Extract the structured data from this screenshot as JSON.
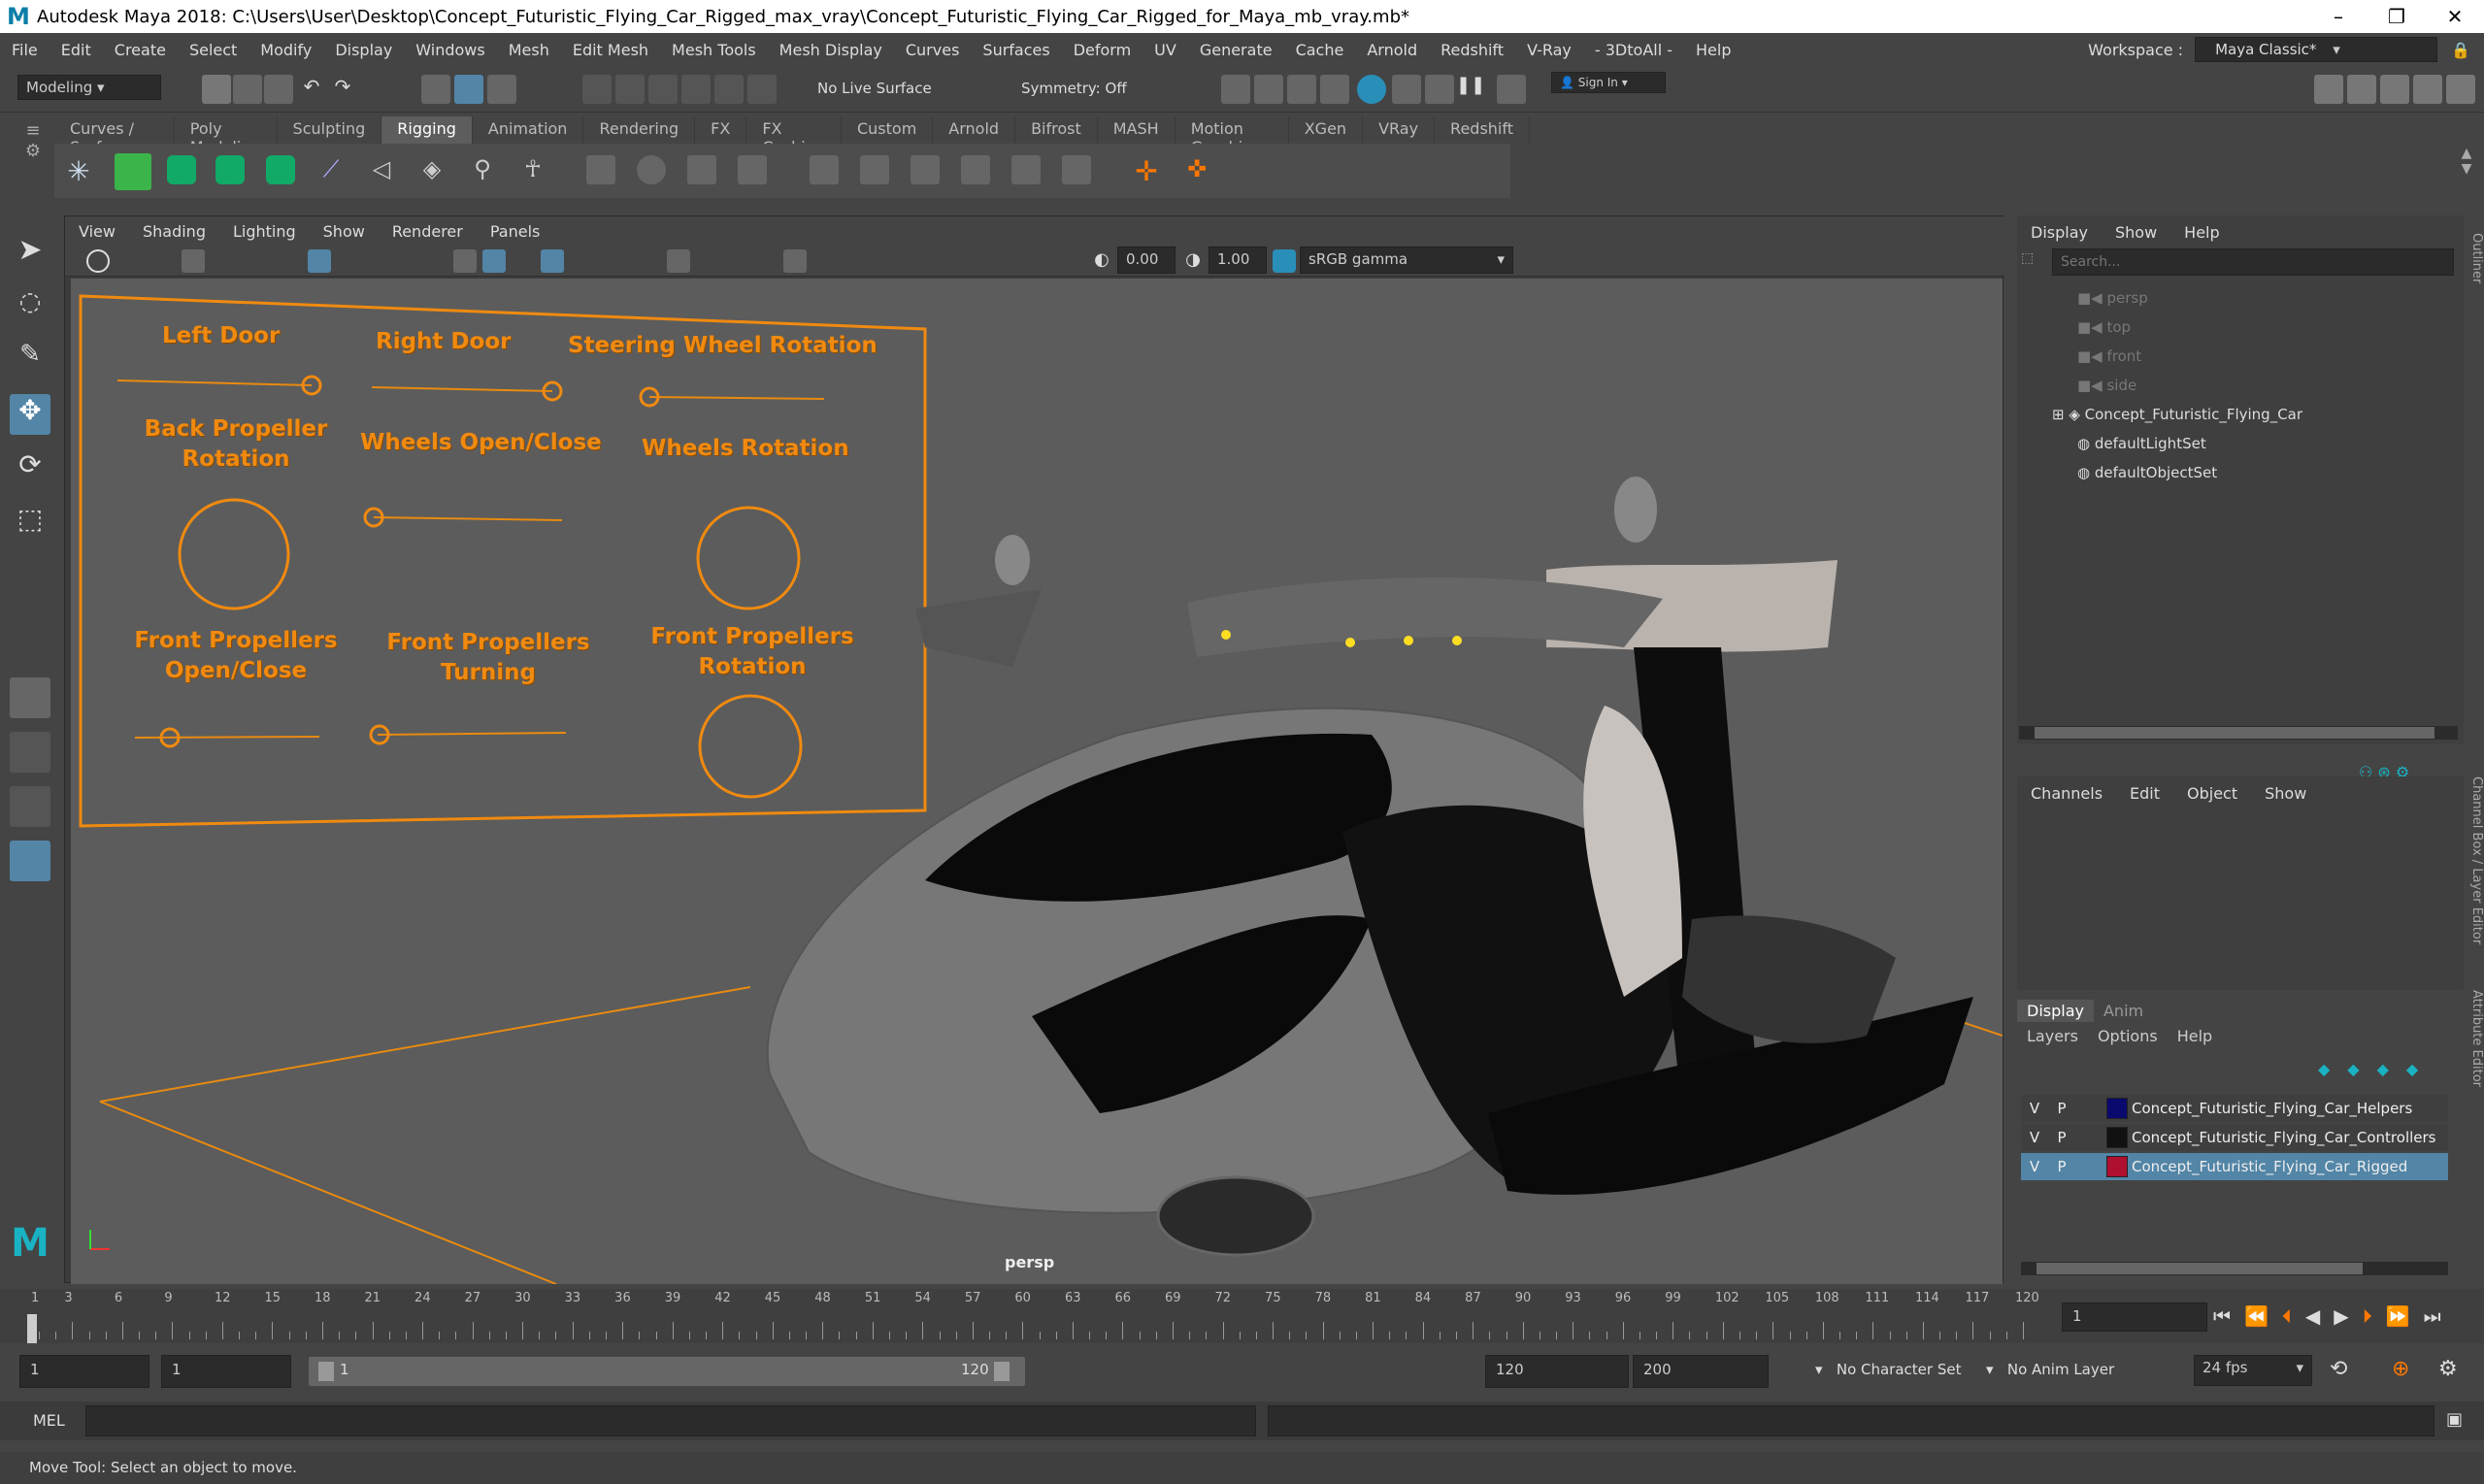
{
  "window": {
    "title": "Autodesk Maya 2018: C:\\Users\\User\\Desktop\\Concept_Futuristic_Flying_Car_Rigged_max_vray\\Concept_Futuristic_Flying_Car_Rigged_for_Maya_mb_vray.mb*",
    "min": "–",
    "max": "❐",
    "close": "✕"
  },
  "menu": [
    "File",
    "Edit",
    "Create",
    "Select",
    "Modify",
    "Display",
    "Windows",
    "Mesh",
    "Edit Mesh",
    "Mesh Tools",
    "Mesh Display",
    "Curves",
    "Surfaces",
    "Deform",
    "UV",
    "Generate",
    "Cache",
    "Arnold",
    "Redshift",
    "V-Ray",
    "- 3DtoAll -",
    "Help"
  ],
  "workspace": {
    "label": "Workspace :",
    "value": "Maya Classic*"
  },
  "status": {
    "mode": "Modeling",
    "live_surface": "No Live Surface",
    "symmetry": "Symmetry: Off",
    "sign_in": "Sign In"
  },
  "shelf_tabs": [
    "Curves / Surfaces",
    "Poly Modeling",
    "Sculpting",
    "Rigging",
    "Animation",
    "Rendering",
    "FX",
    "FX Caching",
    "Custom",
    "Arnold",
    "Bifrost",
    "MASH",
    "Motion Graphics",
    "XGen",
    "VRay",
    "Redshift"
  ],
  "shelf_active": "Rigging",
  "viewport": {
    "menu": [
      "View",
      "Shading",
      "Lighting",
      "Show",
      "Renderer",
      "Panels"
    ],
    "exposure": "0.00",
    "gamma": "1.00",
    "colorspace": "sRGB gamma",
    "camera": "persp"
  },
  "controls": {
    "left_door": "Left Door",
    "right_door": "Right Door",
    "steering": "Steering Wheel Rotation",
    "back_prop_1": "Back Propeller",
    "back_prop_2": "Rotation",
    "wheels_oc": "Wheels Open/Close",
    "wheels_rot": "Wheels Rotation",
    "fp_oc_1": "Front Propellers",
    "fp_oc_2": "Open/Close",
    "fp_turn_1": "Front Propellers",
    "fp_turn_2": "Turning",
    "fp_rot_1": "Front Propellers",
    "fp_rot_2": "Rotation"
  },
  "outliner": {
    "menu": [
      "Display",
      "Show",
      "Help"
    ],
    "search_placeholder": "Search...",
    "items": [
      "persp",
      "top",
      "front",
      "side",
      "Concept_Futuristic_Flying_Car",
      "defaultLightSet",
      "defaultObjectSet"
    ]
  },
  "channelbox": {
    "menu": [
      "Channels",
      "Edit",
      "Object",
      "Show"
    ]
  },
  "layers": {
    "tabs": [
      "Display",
      "Anim"
    ],
    "menu": [
      "Layers",
      "Options",
      "Help"
    ],
    "rows": [
      {
        "v": "V",
        "p": "P",
        "name": "Concept_Futuristic_Flying_Car_Helpers",
        "color": "#0a0a6e"
      },
      {
        "v": "V",
        "p": "P",
        "name": "Concept_Futuristic_Flying_Car_Controllers",
        "color": "#111111"
      },
      {
        "v": "V",
        "p": "P",
        "name": "Concept_Futuristic_Flying_Car_Rigged",
        "color": "#b01030"
      }
    ]
  },
  "side_tabs": [
    "Outliner",
    "Channel Box / Layer Editor",
    "Attribute Editor"
  ],
  "timeline": {
    "ticks": [
      "1",
      "3",
      "6",
      "9",
      "12",
      "15",
      "18",
      "21",
      "24",
      "27",
      "30",
      "33",
      "36",
      "39",
      "42",
      "45",
      "48",
      "51",
      "54",
      "57",
      "60",
      "63",
      "66",
      "69",
      "72",
      "75",
      "78",
      "81",
      "84",
      "87",
      "90",
      "93",
      "96",
      "99",
      "102",
      "105",
      "108",
      "111",
      "114",
      "117",
      "120"
    ],
    "current": "1"
  },
  "range": {
    "start": "1",
    "anim_start": "1",
    "slider_start": "1",
    "slider_end": "120",
    "end": "120",
    "anim_end": "200",
    "char_set": "No Character Set",
    "anim_layer": "No Anim Layer",
    "fps": "24 fps"
  },
  "cmd": {
    "label": "MEL"
  },
  "help": "Move Tool: Select an object to move.",
  "colors": {
    "accent": "#ff8c00",
    "selection": "#5285a6"
  }
}
